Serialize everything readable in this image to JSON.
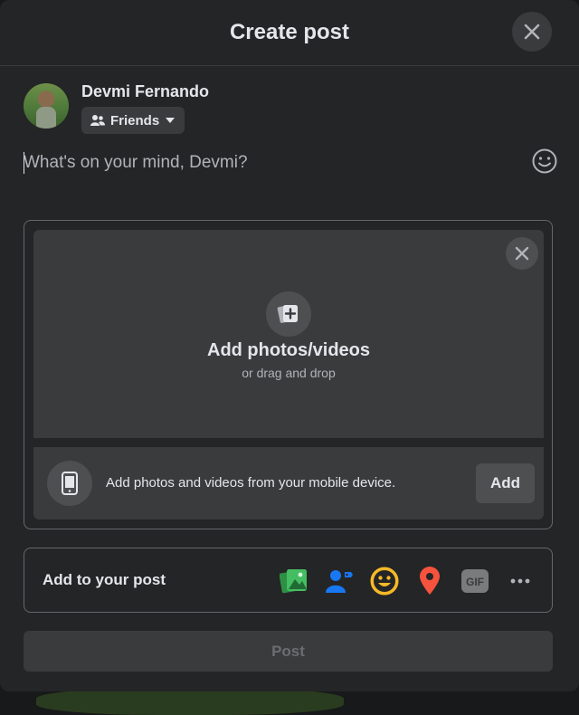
{
  "dialog": {
    "title": "Create post",
    "close_icon": "close-icon"
  },
  "author": {
    "name": "Devmi Fernando",
    "audience": "Friends",
    "audience_icon": "friends-icon"
  },
  "composer": {
    "placeholder": "What's on your mind, Devmi?",
    "value": "",
    "emoji_icon": "smiley-icon"
  },
  "media": {
    "title": "Add photos/videos",
    "subtitle": "or drag and drop",
    "mobile_text": "Add photos and videos from your mobile device.",
    "mobile_add_label": "Add"
  },
  "add_to_post": {
    "label": "Add to your post",
    "tools": [
      {
        "icon": "photo-video-icon",
        "color": "#45bd62"
      },
      {
        "icon": "tag-people-icon",
        "color": "#1877f2"
      },
      {
        "icon": "feeling-icon",
        "color": "#f7b928"
      },
      {
        "icon": "check-in-icon",
        "color": "#f5533d"
      },
      {
        "icon": "gif-icon",
        "color": "#4e4f50"
      },
      {
        "icon": "more-icon",
        "color": "#b0b3b8"
      }
    ]
  },
  "post_button": "Post",
  "colors": {
    "surface": "#242526",
    "panel": "#3a3b3c",
    "text_primary": "#e4e6eb",
    "text_secondary": "#b0b3b8"
  }
}
